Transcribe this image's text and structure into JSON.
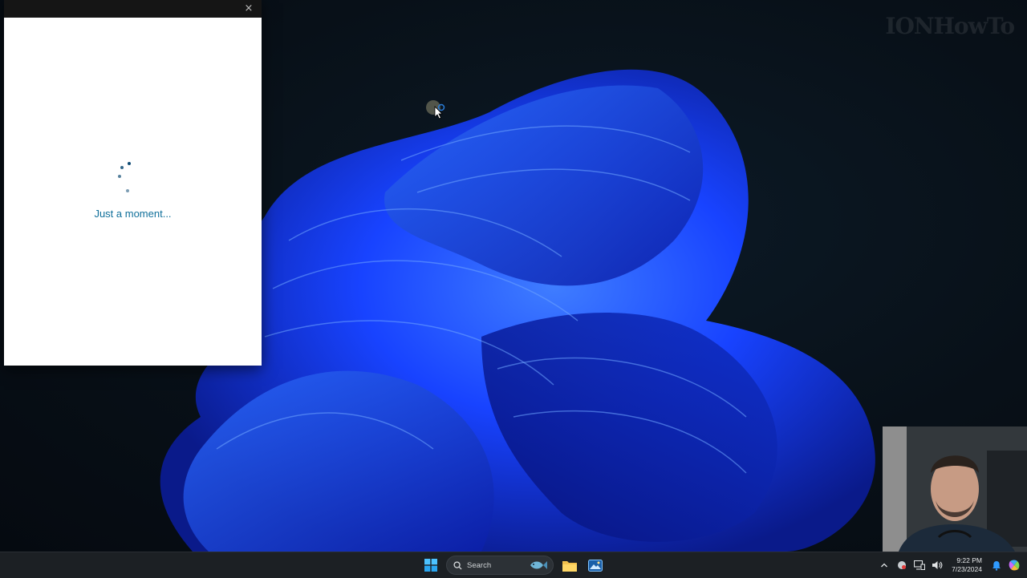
{
  "watermark": {
    "text": "IONHowTo"
  },
  "dialog": {
    "close_glyph": "×",
    "loading_text": "Just a moment..."
  },
  "taskbar": {
    "search_label": "Search",
    "clock_time": "9:22 PM",
    "clock_date": "7/23/2024"
  },
  "colors": {
    "wallpaper_blue": "#1a3fff",
    "spinner": "#0f4b74",
    "loading_text": "#0f6f9a",
    "taskbar": "#1c2024"
  },
  "icons": {
    "start": "windows-start-icon",
    "search": "magnifier-icon",
    "search_highlight": "fish-icon",
    "file_explorer": "folder-icon",
    "photos": "photos-icon",
    "tray_overflow": "chevron-up-icon",
    "app_tray": "app-tray-icon",
    "network": "network-icon",
    "volume": "speaker-icon",
    "notification": "bell-icon",
    "copilot": "copilot-icon"
  }
}
